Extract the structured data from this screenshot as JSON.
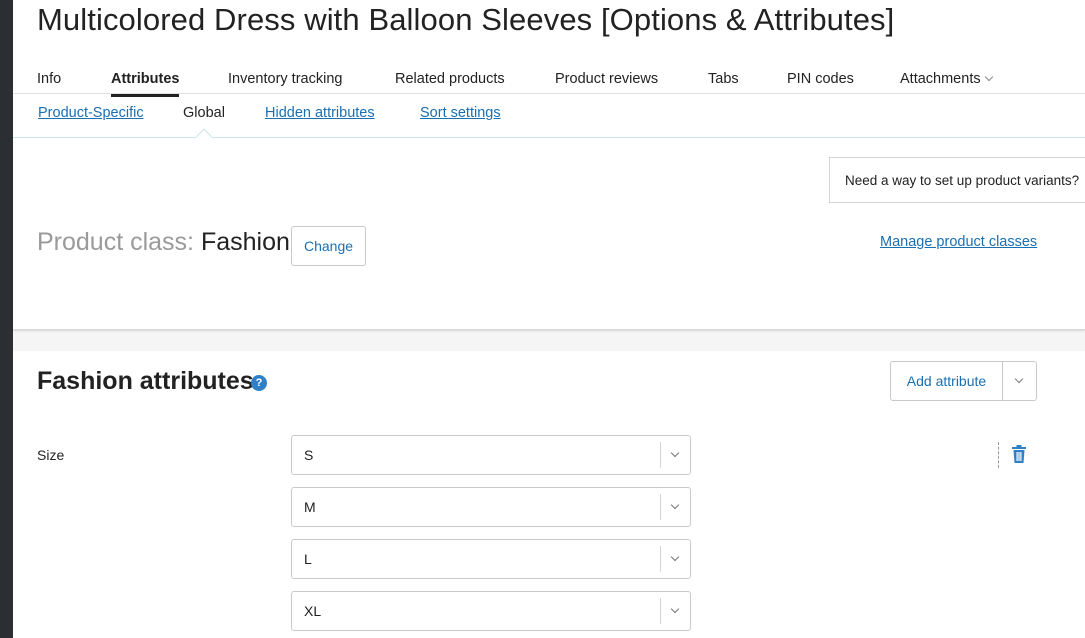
{
  "page": {
    "title": "Multicolored Dress with Balloon Sleeves [Options & Attributes]"
  },
  "tabs": [
    {
      "label": "Info",
      "active": false
    },
    {
      "label": "Attributes",
      "active": true
    },
    {
      "label": "Inventory tracking",
      "active": false
    },
    {
      "label": "Related products",
      "active": false
    },
    {
      "label": "Product reviews",
      "active": false
    },
    {
      "label": "Tabs",
      "active": false
    },
    {
      "label": "PIN codes",
      "active": false
    },
    {
      "label": "Attachments",
      "active": false,
      "has_dropdown": true
    }
  ],
  "subtabs": [
    {
      "label": "Product-Specific",
      "current": false
    },
    {
      "label": "Global",
      "current": true
    },
    {
      "label": "Hidden attributes",
      "current": false
    },
    {
      "label": "Sort settings",
      "current": false
    }
  ],
  "variants_hint": "Need a way to set up product variants?",
  "product_class": {
    "label": "Product class:",
    "value": "Fashion",
    "change_label": "Change",
    "manage_label": "Manage product classes"
  },
  "attributes_section": {
    "title": "Fashion attributes",
    "help_icon": "?",
    "add_label": "Add attribute",
    "attribute": {
      "name": "Size",
      "values": [
        "S",
        "M",
        "L",
        "XL"
      ]
    }
  },
  "colors": {
    "link": "#1a6fb3",
    "help_icon": "#2f80c7",
    "sidebar": "#2b2f33"
  }
}
